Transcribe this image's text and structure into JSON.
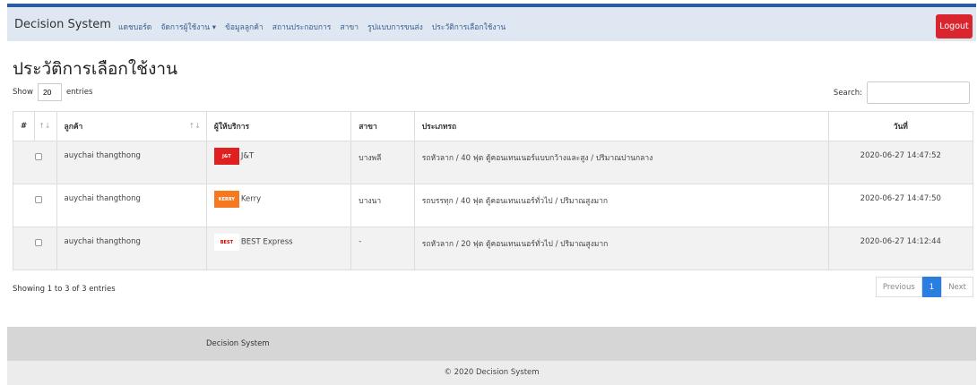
{
  "nav": {
    "brand": "Decision System",
    "items": [
      "แดชบอร์ด",
      "จัดการผู้ใช้งาน ▾",
      "ข้อมูลลูกค้า",
      "สถานประกอบการ",
      "สาขา",
      "รูปแบบการขนส่ง",
      "ประวัติการเลือกใช้งาน"
    ],
    "logout": "Logout"
  },
  "page": {
    "title": "ประวัติการเลือกใช้งาน",
    "show_label": "Show",
    "entries_value": "20",
    "entries_label": "entries",
    "search_label": "Search:",
    "search_value": ""
  },
  "table": {
    "headers": [
      "#",
      "ลูกค้า",
      "ผู้ให้บริการ",
      "สาขา",
      "ประเภทรถ",
      "วันที่"
    ],
    "rows": [
      {
        "customer": "auychai  thangthong",
        "provider": "J&T",
        "logo_text": "J&T",
        "branch": "บางพลี",
        "vehicle": "รถหัวลาก / 40 ฟุต ตู้คอนเทนเนอร์แบบกว้างและสูง / ปริมาณปานกลาง",
        "date": "2020-06-27 14:47:52"
      },
      {
        "customer": "auychai  thangthong",
        "provider": "Kerry",
        "logo_text": "KERRY",
        "branch": "บางนา",
        "vehicle": "รถบรรทุก / 40 ฟุต ตู้คอนเทนเนอร์ทั่วไป / ปริมาณสูงมาก",
        "date": "2020-06-27 14:47:50"
      },
      {
        "customer": "auychai  thangthong",
        "provider": "BEST Express",
        "logo_text": "BEST",
        "branch": "-",
        "vehicle": "รถหัวลาก / 20 ฟุต ตู้คอนเทนเนอร์ทั่วไป / ปริมาณสูงมาก",
        "date": "2020-06-27 14:12:44"
      }
    ]
  },
  "footer_info": "Showing 1 to 3 of 3 entries",
  "pager": {
    "previous": "Previous",
    "current": "1",
    "next": "Next"
  },
  "footer": {
    "brand": "Decision System",
    "copyright": "© 2020 Decision System"
  }
}
